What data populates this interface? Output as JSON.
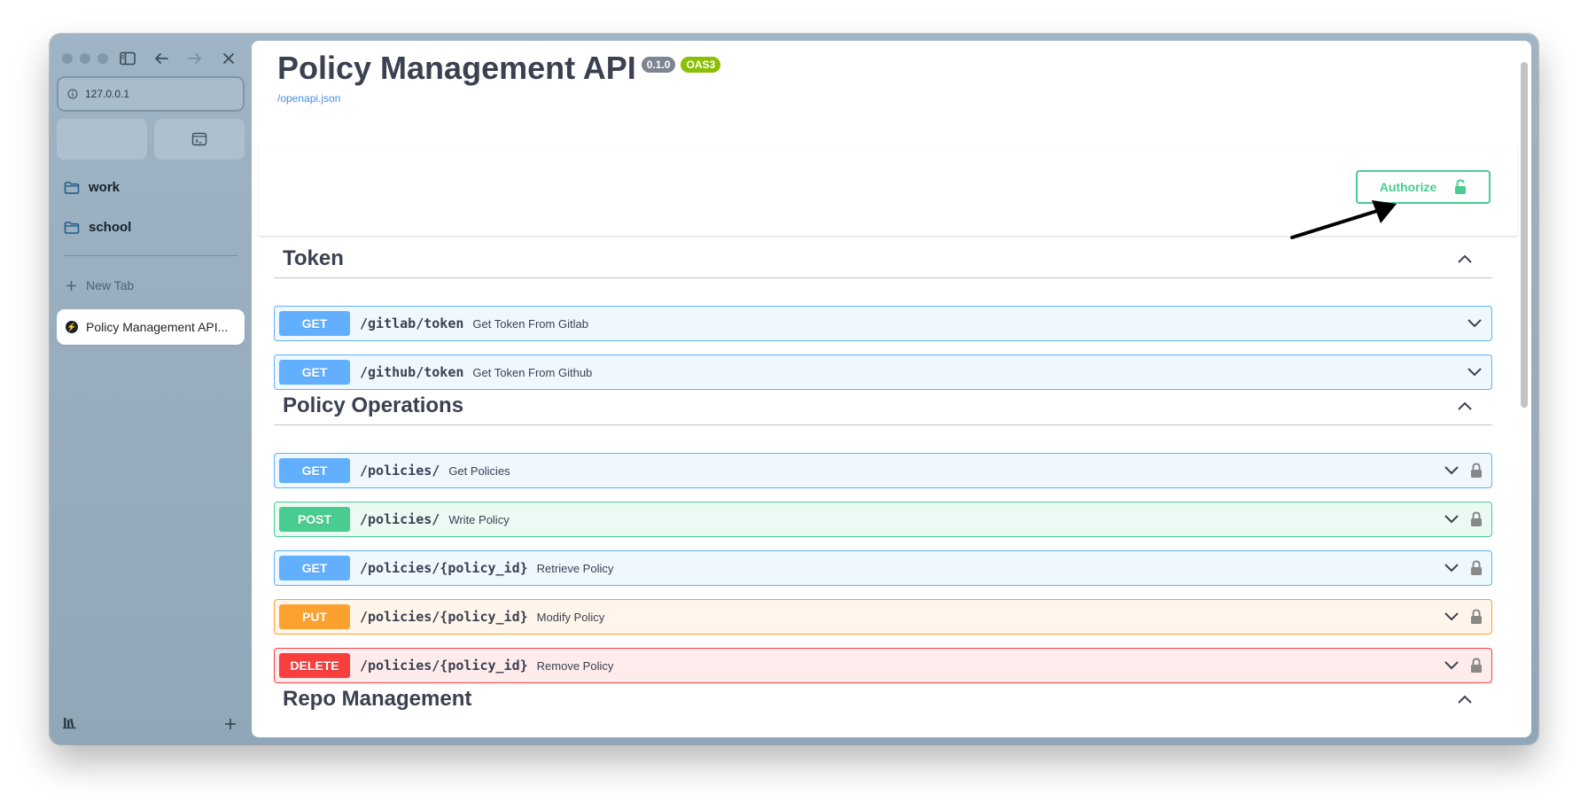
{
  "browser": {
    "url": "127.0.0.1",
    "folders": [
      {
        "label": "work"
      },
      {
        "label": "school"
      }
    ],
    "new_tab_label": "New Tab",
    "active_tab_label": "Policy Management API..."
  },
  "api": {
    "title": "Policy Management API",
    "version": "0.1.0",
    "oas_badge": "OAS3",
    "spec_link": "/openapi.json",
    "authorize_label": "Authorize"
  },
  "sections": [
    {
      "title": "Token",
      "operations": [
        {
          "method": "GET",
          "path": "/gitlab/token",
          "summary": "Get Token From Gitlab"
        },
        {
          "method": "GET",
          "path": "/github/token",
          "summary": "Get Token From Github"
        }
      ]
    },
    {
      "title": "Policy Operations",
      "operations": [
        {
          "method": "GET",
          "path": "/policies/",
          "summary": "Get Policies"
        },
        {
          "method": "POST",
          "path": "/policies/",
          "summary": "Write Policy"
        },
        {
          "method": "GET",
          "path": "/policies/{policy_id}",
          "summary": "Retrieve Policy"
        },
        {
          "method": "PUT",
          "path": "/policies/{policy_id}",
          "summary": "Modify Policy"
        },
        {
          "method": "DELETE",
          "path": "/policies/{policy_id}",
          "summary": "Remove Policy"
        }
      ]
    },
    {
      "title": "Repo Management",
      "operations": []
    }
  ],
  "colors": {
    "get": "#61affe",
    "post": "#49cc90",
    "put": "#fca130",
    "delete": "#f93e3e",
    "authorize": "#49cc90"
  }
}
